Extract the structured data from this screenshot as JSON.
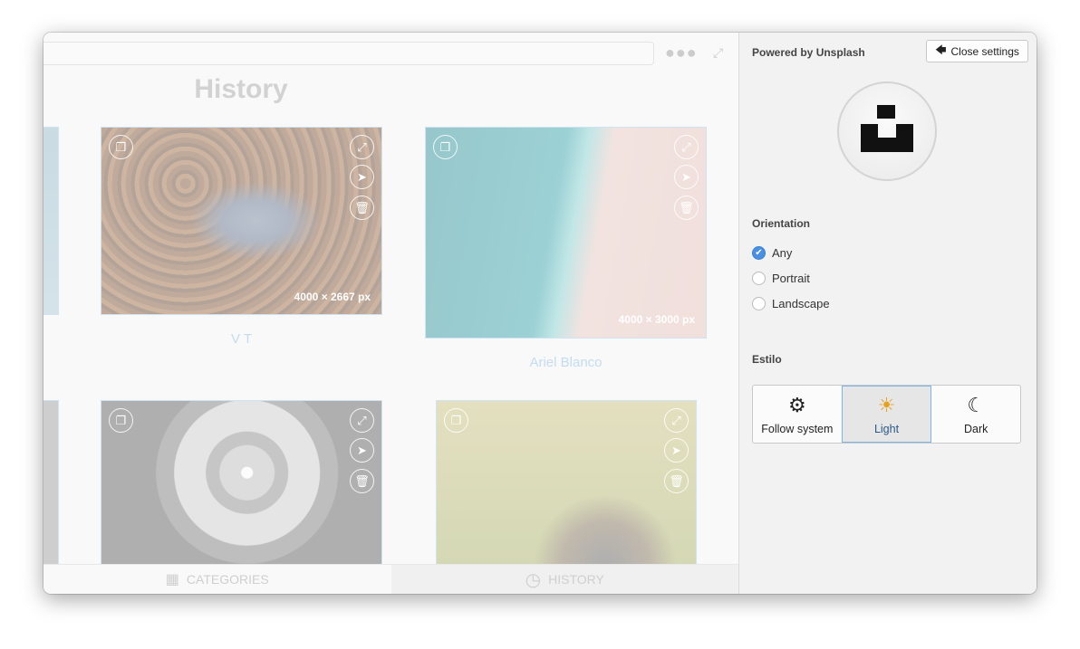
{
  "main": {
    "title": "History",
    "cards": [
      {
        "caption": "V T",
        "dimensions": "4000 × 2667  px"
      },
      {
        "caption": "Ariel Blanco",
        "dimensions": "4000 × 3000  px"
      },
      {
        "caption": "",
        "dimensions": ""
      },
      {
        "caption": "",
        "dimensions": ""
      }
    ],
    "card_icons": [
      "copy-icon",
      "expand-icon",
      "send-icon",
      "trash-icon"
    ],
    "tabs": [
      {
        "label": "CATEGORIES",
        "icon": "grid-icon",
        "active": false
      },
      {
        "label": "HISTORY",
        "icon": "clock-icon",
        "active": true
      }
    ]
  },
  "settings": {
    "powered_by": "Powered by Unsplash",
    "close_label": "Close settings",
    "orientation_label": "Orientation",
    "orientation_options": [
      {
        "label": "Any",
        "checked": true
      },
      {
        "label": "Portrait",
        "checked": false
      },
      {
        "label": "Landscape",
        "checked": false
      }
    ],
    "style_label": "Estilo",
    "style_options": [
      {
        "label": "Follow system",
        "icon": "gear-icon"
      },
      {
        "label": "Light",
        "icon": "sun-icon",
        "selected": true
      },
      {
        "label": "Dark",
        "icon": "moon-icon"
      }
    ],
    "accent": "#4a90e2",
    "sun_color": "#e8a020"
  }
}
